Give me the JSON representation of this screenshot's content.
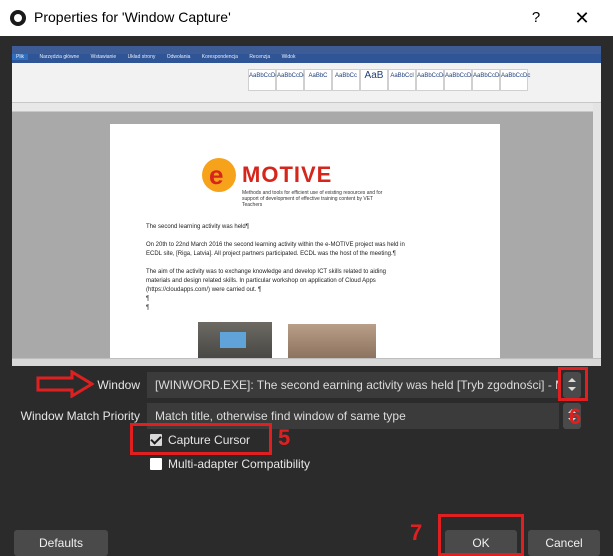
{
  "window_title": "Properties for 'Window Capture'",
  "title_controls": {
    "help": "?",
    "close": "✕"
  },
  "preview": {
    "ribbon_tabs": [
      "Plik",
      "Narzędzia główne",
      "Wstawianie",
      "Układ strony",
      "Odwołania",
      "Korespondencja",
      "Recenzja",
      "Widok"
    ],
    "style_samples": [
      "AaBbCcDc",
      "AaBbCcDc",
      "AaBbC",
      "AaBbCc",
      "AaB",
      "AaBbCcl",
      "AaBbCcDc",
      "AaBbCcDc",
      "AaBbCcDc",
      "AaBbCcDc"
    ],
    "doc": {
      "logo_text": "MOTIVE",
      "logo_subtitle": "Methods and tools for efficient use of existing resources and for support of development of effective training content by VET Teachers",
      "lines": [
        "The second learning activity was held¶",
        "On 20th to 22nd March 2016 the second learning activity within the e-MOTIVE project was held in",
        "ECDL site, [Riga, Latvia]. All project partners participated. ECDL was the host of the meeting.¶",
        "The aim of the activity was to exchange knowledge and develop ICT skills related to aiding",
        "materials and design related skills. In particular workshop on application of Cloud Apps",
        "(https://cloudapps.com/) were carried out. ¶",
        "¶",
        "¶"
      ]
    }
  },
  "form": {
    "window_label": "Window",
    "window_value": "[WINWORD.EXE]: The second earning activity was held [Tryb zgodności] - Micro",
    "match_priority_label": "Window Match Priority",
    "match_priority_value": "Match title, otherwise find window of same type",
    "capture_cursor_label": "Capture Cursor",
    "capture_cursor_checked": true,
    "multi_adapter_label": "Multi-adapter Compatibility",
    "multi_adapter_checked": false
  },
  "buttons": {
    "defaults": "Defaults",
    "ok": "OK",
    "cancel": "Cancel"
  },
  "annotations": {
    "step5": "5",
    "step6": "6",
    "step7": "7",
    "color": "#e02020"
  },
  "colors": {
    "dialog_bg": "#2b2b2b",
    "control_bg": "#3b3b3b",
    "button_bg": "#4a4a4a"
  }
}
